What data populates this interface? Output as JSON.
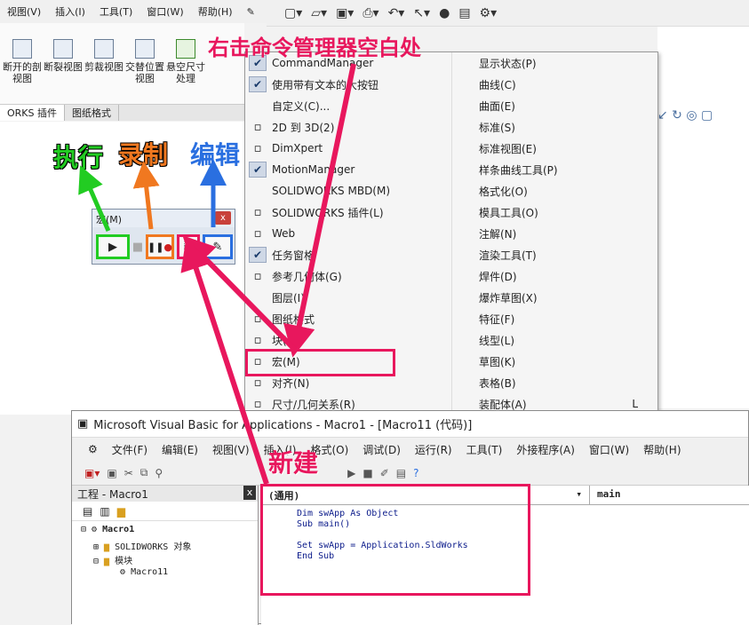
{
  "app": {
    "menubar": [
      "视图(V)",
      "插入(I)",
      "工具(T)",
      "窗口(W)",
      "帮助(H)"
    ],
    "ribbon": [
      {
        "label": "断开的剖视图"
      },
      {
        "label": "断裂视图"
      },
      {
        "label": "剪裁视图"
      },
      {
        "label": "交替位置视图"
      },
      {
        "label": "悬空尺寸处理"
      }
    ],
    "tabs": [
      "ORKS 插件",
      "图纸格式"
    ]
  },
  "context_menu": {
    "col1": [
      {
        "label": "CommandManager",
        "checked": true
      },
      {
        "label": "使用带有文本的大按钮",
        "checked": true
      },
      {
        "label": "自定义(C)...",
        "checked": false
      },
      {
        "label": "2D 到 3D(2)",
        "icon": "2d-to-3d-icon"
      },
      {
        "label": "DimXpert",
        "icon": "dimxpert-icon"
      },
      {
        "label": "MotionManager",
        "checked": true
      },
      {
        "label": "SOLIDWORKS MBD(M)"
      },
      {
        "label": "SOLIDWORKS 插件(L)",
        "icon": "solidworks-addin-icon"
      },
      {
        "label": "Web",
        "icon": "globe-icon"
      },
      {
        "label": "任务窗格",
        "checked": true
      },
      {
        "label": "参考几何体(G)",
        "icon": "reference-geometry-icon"
      },
      {
        "label": "图层(I)"
      },
      {
        "label": "图纸格式",
        "icon": "sheet-format-icon"
      },
      {
        "label": "块(B)",
        "icon": "block-icon"
      },
      {
        "label": "宏(M)",
        "icon": "macro-icon"
      },
      {
        "label": "对齐(N)",
        "icon": "align-icon"
      },
      {
        "label": "尺寸/几何关系(R)",
        "icon": "dimension-icon"
      }
    ],
    "col2": [
      {
        "label": "显示状态(P)"
      },
      {
        "label": "曲线(C)"
      },
      {
        "label": "曲面(E)"
      },
      {
        "label": "标准(S)"
      },
      {
        "label": "标准视图(E)"
      },
      {
        "label": "样条曲线工具(P)"
      },
      {
        "label": "格式化(O)"
      },
      {
        "label": "模具工具(O)"
      },
      {
        "label": "注解(N)"
      },
      {
        "label": "渲染工具(T)"
      },
      {
        "label": "焊件(D)"
      },
      {
        "label": "爆炸草图(X)"
      },
      {
        "label": "特征(F)"
      },
      {
        "label": "线型(L)"
      },
      {
        "label": "草图(K)"
      },
      {
        "label": "表格(B)"
      },
      {
        "label": "装配体(A)",
        "shortcut": "L"
      }
    ]
  },
  "macro_toolbar": {
    "title": "宏(M)",
    "close": "x"
  },
  "annotations": {
    "right_click": "右击命令管理器空白处",
    "execute": "执行",
    "record": "录制",
    "edit": "编辑",
    "new": "新建"
  },
  "vba": {
    "title": "Microsoft Visual Basic for Applications - Macro1 - [Macro11 (代码)]",
    "menu": [
      "文件(F)",
      "编辑(E)",
      "视图(V)",
      "插入(I)",
      "格式(O)",
      "调试(D)",
      "运行(R)",
      "工具(T)",
      "外接程序(A)",
      "窗口(W)",
      "帮助(H)"
    ],
    "project_title": "工程 - Macro1",
    "tree": [
      "Macro1",
      "SOLIDWORKS 对象",
      "模块",
      "Macro11"
    ],
    "combo_left": "(通用)",
    "combo_right": "main",
    "code": "Dim swApp As Object\nSub main()\n\nSet swApp = Application.SldWorks\nEnd Sub"
  },
  "colors": {
    "highlight": "#e8175d",
    "exec": "#22cc22",
    "record": "#f07820",
    "edit": "#2a6fe0"
  }
}
